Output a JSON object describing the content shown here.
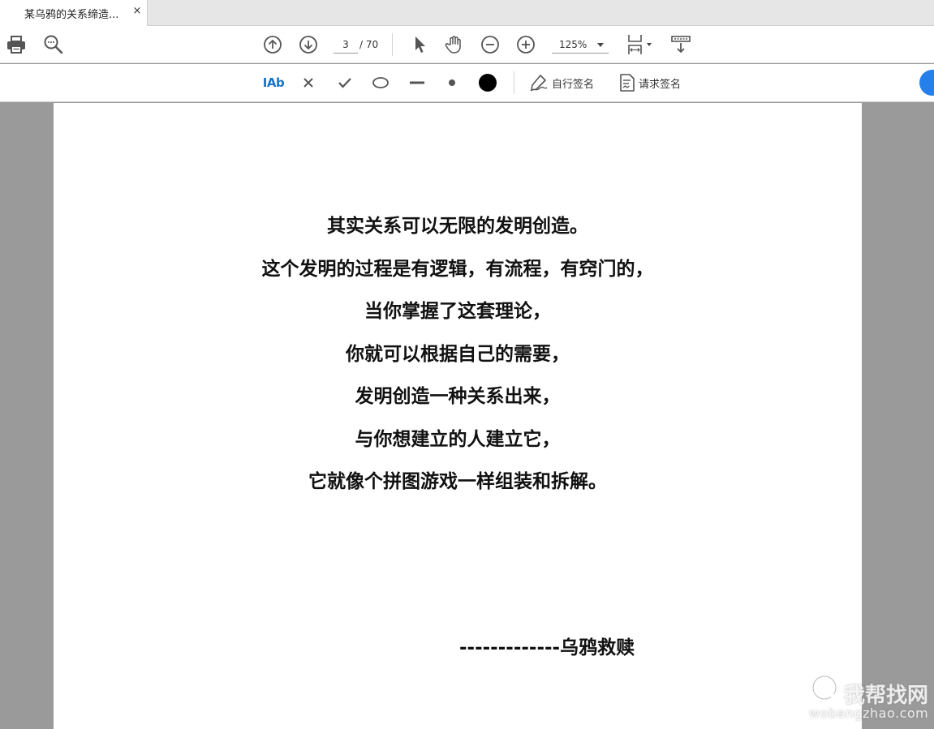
{
  "tab": {
    "title": "某乌鸦的关系缔造...",
    "close_glyph": "×"
  },
  "toolbar": {
    "page_current": "3",
    "page_total": "/ 70",
    "zoom": "125%",
    "icons": [
      "print-icon",
      "search-icon",
      "arrow-up-circle-icon",
      "arrow-down-circle-icon",
      "select-arrow-icon",
      "hand-icon",
      "zoom-out-icon",
      "zoom-in-icon",
      "fit-page-icon",
      "scroll-mode-icon"
    ]
  },
  "signbar": {
    "text_tool": "IAb",
    "self_sign": "自行签名",
    "request_sign": "请求签名"
  },
  "document": {
    "lines": [
      "其实关系可以无限的发明创造。",
      "这个发明的过程是有逻辑，有流程，有窍门的，",
      "当你掌握了这套理论，",
      "你就可以根据自己的需要，",
      "发明创造一种关系出来，",
      "与你想建立的人建立它，",
      "它就像个拼图游戏一样组装和拆解。"
    ],
    "signature": "-------------乌鸦救赎"
  },
  "watermark": {
    "name": "我帮找网",
    "url": "wobangzhao.com"
  },
  "colors": {
    "accent": "#2680eb",
    "viewer_bg": "#9a9a9a"
  }
}
